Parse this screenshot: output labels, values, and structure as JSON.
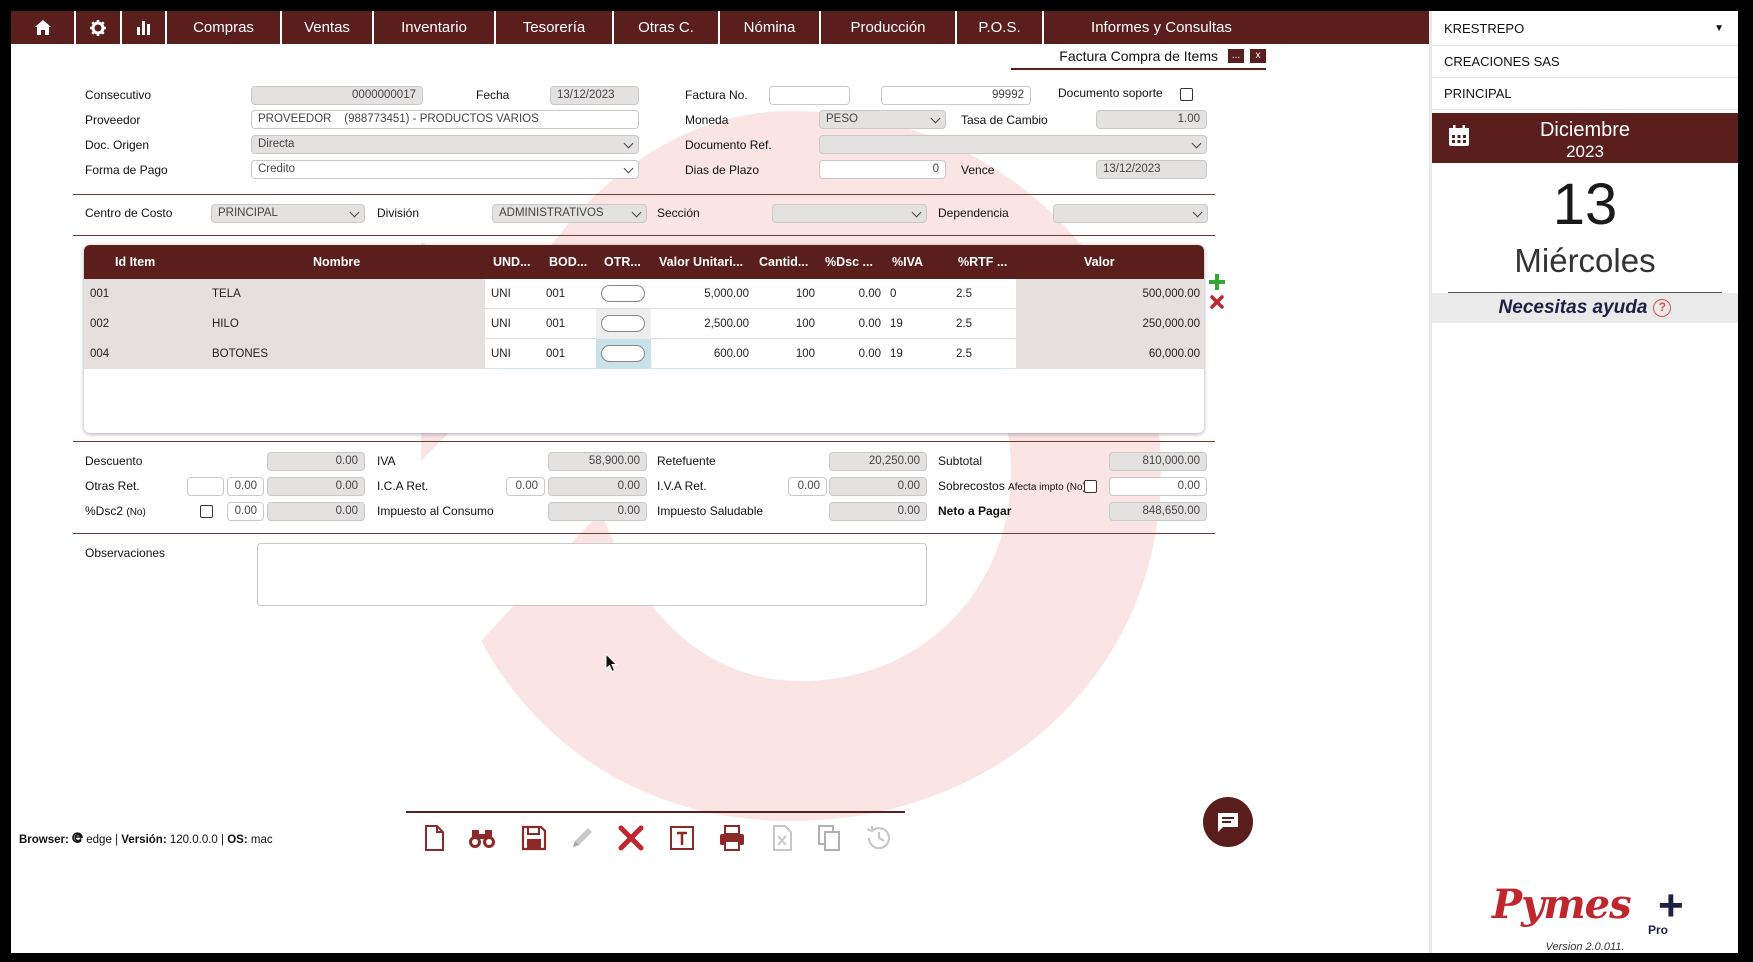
{
  "nav": {
    "items": [
      "Compras",
      "Ventas",
      "Inventario",
      "Tesorería",
      "Otras C.",
      "Nómina",
      "Producción",
      "P.O.S.",
      "Informes y Consultas"
    ]
  },
  "sidebar": {
    "user": "KRESTREPO",
    "company": "CREACIONES SAS",
    "branch": "PRINCIPAL",
    "month": "Diciembre",
    "year": "2023",
    "day": "13",
    "weekday": "Miércoles",
    "help": "Necesitas ayuda",
    "help_icon": "?",
    "logo_text": "Pymes",
    "logo_plus": "+",
    "logo_sub": "Pro",
    "version": "Version 2.0.011."
  },
  "window": {
    "title": "Factura Compra de Items",
    "minimize": "...",
    "close": "x"
  },
  "header": {
    "consecutivo_label": "Consecutivo",
    "consecutivo": "0000000017",
    "fecha_label": "Fecha",
    "fecha": "13/12/2023",
    "factura_label": "Factura No.",
    "factura_prefijo": "",
    "factura_numero": "99992",
    "doc_soporte_label": "Documento soporte",
    "proveedor_label": "Proveedor",
    "proveedor": "PROVEEDOR    (988773451) - PRODUCTOS VARIOS",
    "moneda_label": "Moneda",
    "moneda": "PESO",
    "tasa_label": "Tasa de Cambio",
    "tasa": "1.00",
    "doc_origen_label": "Doc. Origen",
    "doc_origen": "Directa",
    "doc_ref_label": "Documento Ref.",
    "doc_ref": "",
    "forma_pago_label": "Forma de Pago",
    "forma_pago": "Credito",
    "dias_plazo_label": "Dias de Plazo",
    "dias_plazo": "0",
    "vence_label": "Vence",
    "vence": "13/12/2023",
    "centro_costo_label": "Centro de Costo",
    "centro_costo": "PRINCIPAL",
    "division_label": "División",
    "division": "ADMINISTRATIVOS",
    "seccion_label": "Sección",
    "seccion": "",
    "dependencia_label": "Dependencia",
    "dependencia": ""
  },
  "grid": {
    "columns": [
      "Id Item",
      "Nombre",
      "UND...",
      "BOD...",
      "OTR...",
      "Valor Unitari...",
      "Cantid...",
      "%Dsc ...",
      "%IVA",
      "%RTF ...",
      "Valor"
    ],
    "rows": [
      {
        "id": "001",
        "nombre": "TELA",
        "und": "UNI",
        "bod": "001",
        "valor_unitario": "5,000.00",
        "cantidad": "100",
        "dsc": "0.00",
        "iva": "0",
        "rtf": "2.5",
        "valor": "500,000.00"
      },
      {
        "id": "002",
        "nombre": "HILO",
        "und": "UNI",
        "bod": "001",
        "valor_unitario": "2,500.00",
        "cantidad": "100",
        "dsc": "0.00",
        "iva": "19",
        "rtf": "2.5",
        "valor": "250,000.00"
      },
      {
        "id": "004",
        "nombre": "BOTONES",
        "und": "UNI",
        "bod": "001",
        "valor_unitario": "600.00",
        "cantidad": "100",
        "dsc": "0.00",
        "iva": "19",
        "rtf": "2.5",
        "valor": "60,000.00"
      }
    ]
  },
  "totals": {
    "descuento_label": "Descuento",
    "descuento": "0.00",
    "iva_label": "IVA",
    "iva": "58,900.00",
    "retefuente_label": "Retefuente",
    "retefuente": "20,250.00",
    "subtotal_label": "Subtotal",
    "subtotal": "810,000.00",
    "otras_ret_label": "Otras Ret.",
    "otras_ret_code": "",
    "otras_ret_pct": "0.00",
    "otras_ret": "0.00",
    "ica_label": "I.C.A Ret.",
    "ica_pct": "0.00",
    "ica": "0.00",
    "iva_ret_label": "I.V.A Ret.",
    "iva_ret_pct": "0.00",
    "iva_ret": "0.00",
    "sobrecostos_label": "Sobrecostos",
    "sobrecostos_note": "Afecta impto (No)",
    "sobrecostos": "0.00",
    "dsc2_label": "%Dsc2",
    "dsc2_note": "(No)",
    "dsc2_pct": "0.00",
    "dsc2": "0.00",
    "consumo_label": "Impuesto al Consumo",
    "consumo": "0.00",
    "saludable_label": "Impuesto Saludable",
    "saludable": "0.00",
    "neto_label": "Neto a Pagar",
    "neto": "848,650.00",
    "observaciones_label": "Observaciones",
    "observaciones": ""
  },
  "status": {
    "browser_label": "Browser:",
    "browser": "edge",
    "version_label": "Versión:",
    "version": "120.0.0.0",
    "os_label": "OS:",
    "os": "mac",
    "separator": "|"
  },
  "toolbar_icons": [
    "new-document-icon",
    "search-binoculars-icon",
    "save-icon",
    "edit-pencil-icon",
    "delete-x-icon",
    "text-icon",
    "print-icon",
    "excel-export-icon",
    "copy-icon",
    "history-icon"
  ],
  "colors": {
    "brand": "#5a1f1c",
    "accent_red": "#c0262d",
    "add_green": "#35a535"
  }
}
